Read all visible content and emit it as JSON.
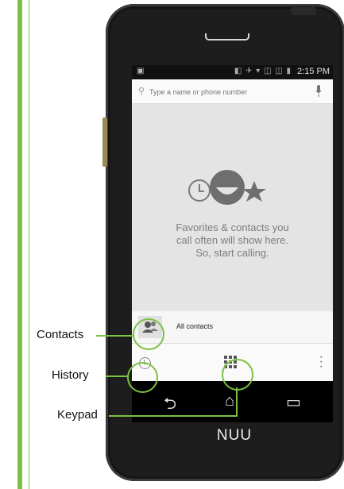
{
  "status_bar": {
    "time": "2:15 PM",
    "icons": "◧ ✈ ▾ ◫ ◫ ▮"
  },
  "search": {
    "placeholder": "Type a name or phone number",
    "icon": "search-icon"
  },
  "empty_state": {
    "message": "Favorites & contacts you\ncall often will show here.\nSo, start calling."
  },
  "contacts_row": {
    "label": "All contacts"
  },
  "callouts": {
    "contacts": "Contacts",
    "history": "History",
    "keypad": "Keypad"
  },
  "brand": "NUU",
  "colors": {
    "accent": "#7bc142",
    "screen_bg": "#e4e4e4",
    "phone_body": "#1d1d1d"
  },
  "icons": {
    "history": "clock-icon",
    "keypad": "dialpad-icon",
    "menu": "overflow-menu-icon",
    "nav": [
      "back-icon",
      "home-icon",
      "recents-icon"
    ]
  }
}
